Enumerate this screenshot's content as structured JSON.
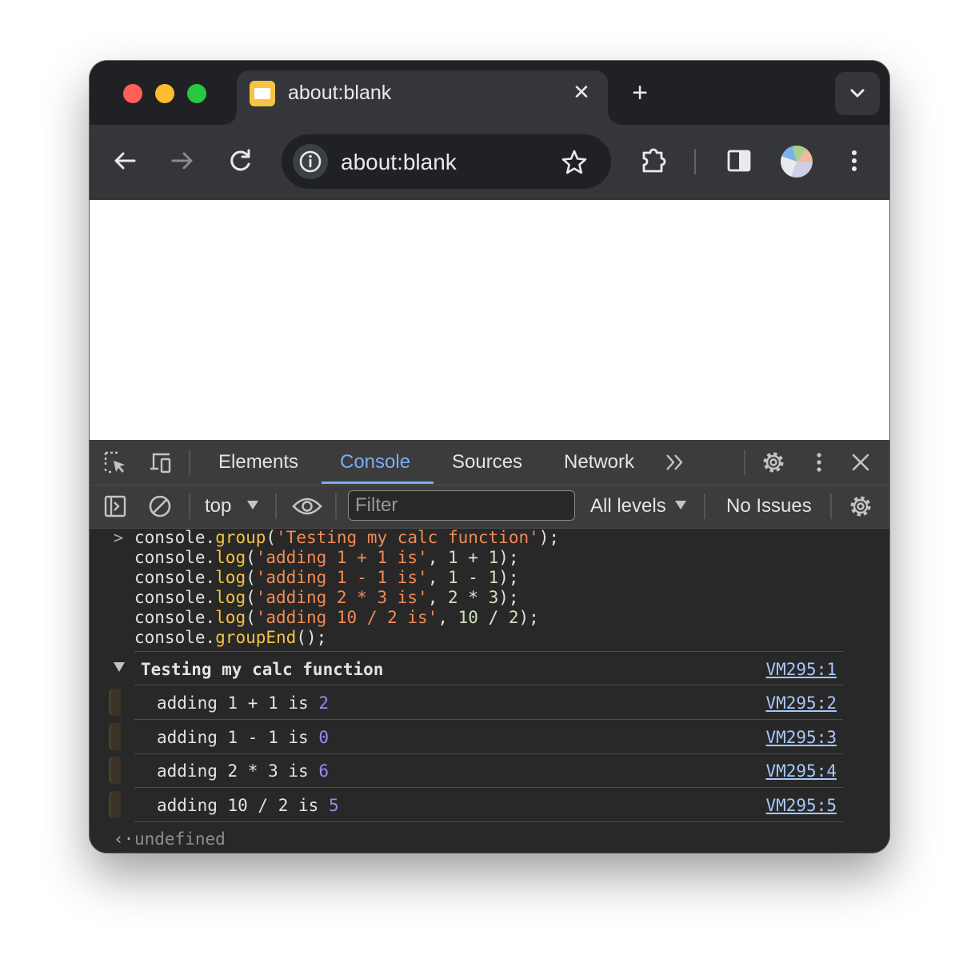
{
  "browser": {
    "tab": {
      "title": "about:blank"
    },
    "omnibox": {
      "url": "about:blank"
    }
  },
  "devtools": {
    "tabs": [
      {
        "label": "Elements"
      },
      {
        "label": "Console",
        "active": true
      },
      {
        "label": "Sources"
      },
      {
        "label": "Network"
      }
    ],
    "context": "top",
    "filter_placeholder": "Filter",
    "levels": "All levels",
    "issues": "No Issues"
  },
  "console": {
    "input_lines": [
      "console.group('Testing my calc function');",
      "console.log('adding 1 + 1 is', 1 + 1);",
      "console.log('adding 1 - 1 is', 1 - 1);",
      "console.log('adding 2 * 3 is', 2 * 3);",
      "console.log('adding 10 / 2 is', 10 / 2);",
      "console.groupEnd();"
    ],
    "group": {
      "title": "Testing my calc function",
      "source": "VM295:1"
    },
    "logs": [
      {
        "text": "adding 1 + 1 is",
        "value": "2",
        "source": "VM295:2"
      },
      {
        "text": "adding 1 - 1 is",
        "value": "0",
        "source": "VM295:3"
      },
      {
        "text": "adding 2 * 3 is",
        "value": "6",
        "source": "VM295:4"
      },
      {
        "text": "adding 10 / 2 is",
        "value": "5",
        "source": "VM295:5"
      }
    ],
    "result": "undefined"
  },
  "colors": {
    "accent": "#7cacf8",
    "string": "#f28b54",
    "function": "#f6c443",
    "number": "#9f86ff",
    "link": "#a8c7fa"
  }
}
